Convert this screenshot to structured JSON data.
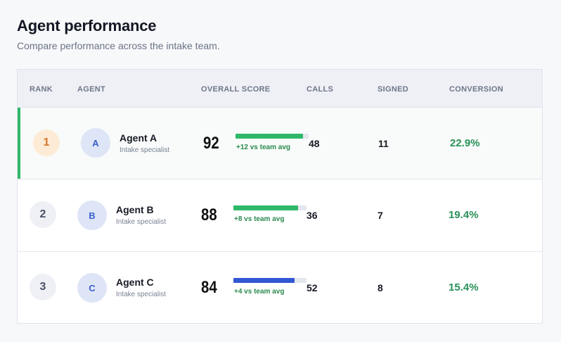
{
  "header": {
    "title": "Agent performance",
    "subtitle": "Compare performance across the intake team."
  },
  "columns": {
    "rank": "RANK",
    "agent": "AGENT",
    "overall_score": "OVERALL SCORE",
    "calls": "CALLS",
    "signed": "SIGNED",
    "conversion": "CONVERSION"
  },
  "rows": [
    {
      "rank": "1",
      "avatar": "A",
      "name": "Agent A",
      "role": "Intake specialist",
      "score": "92",
      "score_fill": 0.92,
      "delta": "+12 vs team avg",
      "calls": "48",
      "signed": "11",
      "conversion": "22.9%"
    },
    {
      "rank": "2",
      "avatar": "B",
      "name": "Agent B",
      "role": "Intake specialist",
      "score": "88",
      "score_fill": 0.88,
      "delta": "+8 vs team avg",
      "calls": "36",
      "signed": "7",
      "conversion": "19.4%"
    },
    {
      "rank": "3",
      "avatar": "C",
      "name": "Agent C",
      "role": "Intake specialist",
      "score": "84",
      "score_fill": 0.84,
      "delta": "+4 vs team avg",
      "calls": "52",
      "signed": "8",
      "conversion": "15.4%"
    }
  ],
  "colors": {
    "accent_green": "#2fb86a",
    "bar_blue": "#3358d4",
    "conversion_green": "#2a9158",
    "rank_gold_bg": "#fdebd6",
    "rank_gold_text": "#d4762a"
  }
}
